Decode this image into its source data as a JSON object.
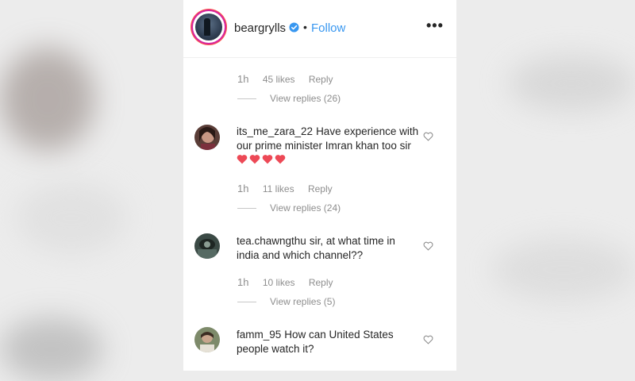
{
  "header": {
    "username": "beargrylls",
    "dot": "•",
    "follow_label": "Follow",
    "more_label": "•••"
  },
  "comments": [
    {
      "user": "",
      "text": "",
      "time": "1h",
      "likes": "45 likes",
      "reply": "Reply",
      "view_replies": "View replies (26)"
    },
    {
      "user": "its_me_zara_22",
      "text": "Have experience with our prime minister Imran khan too sir",
      "emoji": "❤❤❤❤",
      "time": "1h",
      "likes": "11 likes",
      "reply": "Reply",
      "view_replies": "View replies (24)"
    },
    {
      "user": "tea.chawngthu",
      "text": "sir, at what time in india and which channel??",
      "time": "1h",
      "likes": "10 likes",
      "reply": "Reply",
      "view_replies": "View replies (5)"
    },
    {
      "user": "famm_95",
      "text": "How can United States people watch it?"
    }
  ],
  "colors": {
    "follow": "#3897f0",
    "verified": "#3897f0",
    "heart": "#ed4956",
    "muted": "#8e8e8e"
  },
  "icons": {
    "verified": "verified-badge-icon",
    "like": "heart-outline-icon",
    "more": "more-options-icon"
  }
}
